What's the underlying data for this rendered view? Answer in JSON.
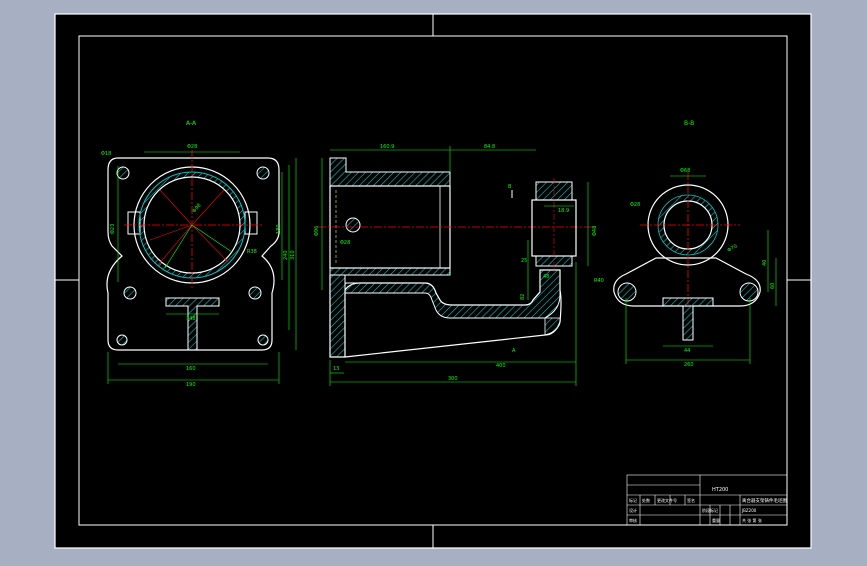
{
  "views": {
    "left_label": "A-A",
    "right_label": "B-B"
  },
  "dimensions": {
    "left_view": {
      "corner_hole": "Φ18",
      "top_width": "Φ28",
      "left_width": "Φ23",
      "radius_a": "Φ98",
      "radius_b": "R38",
      "right_1": "180",
      "right_2": "240",
      "right_3": "310",
      "rib_width": "148",
      "bottom_1": "160",
      "bottom_2": "190"
    },
    "middle_view": {
      "top_left": "160.9",
      "top_right": "84.8",
      "left_dia": "Φ96",
      "hole": "Φ28",
      "section_mark": "B",
      "small_top": "18.9",
      "small_right": "Φ48",
      "height_1": "25",
      "height_2": "48",
      "offset": "82",
      "bottom_left": "13",
      "bottom_mid": "400",
      "bottom_total": "300",
      "section_bottom": "A"
    },
    "right_view": {
      "top": "Φ68",
      "left_hole": "Φ28",
      "right_dia": "Φ70",
      "right_height": "40",
      "side": "60",
      "left_radius": "R40",
      "bottom_1": "44",
      "bottom_2": "260"
    }
  },
  "title_block": {
    "drawing_no": "JBZ200",
    "drawing_name": "离合器支架铸件毛坯图",
    "material": "HT200",
    "scale_label": "比例",
    "weight_label": "重量",
    "sheet_label": "共 张 第 张",
    "rows": [
      "标记",
      "处数",
      "分区",
      "更改文件号",
      "签名",
      "年月日"
    ],
    "roles": [
      "设计",
      "审核",
      "工艺"
    ],
    "stage_labels": [
      "阶段标记",
      "重量",
      "比例"
    ]
  },
  "colors": {
    "background": "#a7b0c3",
    "sheet": "#000000",
    "outline": "#ffffff",
    "dimension": "#00ff00",
    "hatch": "#00c8c8",
    "centerline": "#ff0000",
    "hidden_line": "#ffff00"
  }
}
